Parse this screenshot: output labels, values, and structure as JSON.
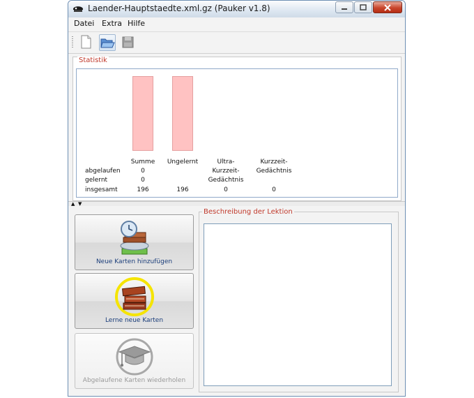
{
  "window": {
    "title": "Laender-Hauptstaedte.xml.gz (Pauker v1.8)"
  },
  "menubar": {
    "items": [
      "Datei",
      "Extra",
      "Hilfe"
    ]
  },
  "toolbar": {
    "buttons": [
      "new-file-icon",
      "open-folder-icon",
      "save-disk-icon"
    ]
  },
  "statistics": {
    "title": "Statistik",
    "columns": [
      "Summe",
      "Ungelernt",
      "Ultra-Kurzzeit-Gedächtnis",
      "Kurzzeit-Gedächtnis"
    ],
    "column_lines": {
      "summe": "Summe",
      "ungelernt": "Ungelernt",
      "ultra1": "Ultra-",
      "ultra2": "Kurzzeit-",
      "ultra3": "Gedächtnis",
      "kurz1": "Kurzzeit-",
      "kurz2": "Gedächtnis"
    },
    "rows": {
      "abgelaufen": {
        "label": "abgelaufen",
        "summe": "0"
      },
      "gelernt": {
        "label": "gelernt",
        "summe": "0"
      },
      "insgesamt": {
        "label": "insgesamt",
        "summe": "196",
        "ungelernt": "196",
        "ultra": "0",
        "kurz": "0"
      }
    },
    "bars": {
      "summe_fraction": 1.0,
      "ungelernt_fraction": 1.0
    },
    "bar_color": "#ffc2c2"
  },
  "actions": {
    "add_cards": "Neue Karten hinzufügen",
    "learn_new": "Lerne neue Karten",
    "repeat_expired": "Abgelaufene Karten wiederholen"
  },
  "description": {
    "title": "Beschreibung der Lektion",
    "text": ""
  },
  "colors": {
    "accent_red": "#c0392b",
    "label_blue": "#1a3d7a"
  }
}
